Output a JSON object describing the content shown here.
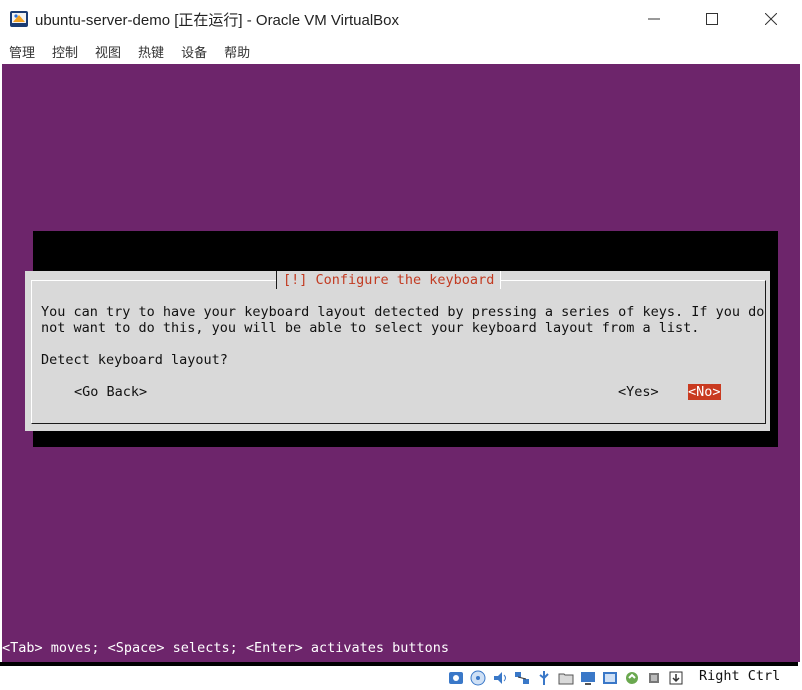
{
  "window": {
    "title": "ubuntu-server-demo [正在运行] - Oracle VM VirtualBox",
    "minimize_icon": "minimize-icon",
    "maximize_icon": "maximize-icon",
    "close_icon": "close-icon"
  },
  "menubar": {
    "items": [
      {
        "label": "管理"
      },
      {
        "label": "控制"
      },
      {
        "label": "视图"
      },
      {
        "label": "热键"
      },
      {
        "label": "设备"
      },
      {
        "label": "帮助"
      }
    ]
  },
  "vm": {
    "background_color": "#6d256b",
    "dialog": {
      "title": "[!] Configure the keyboard",
      "line1": "You can try to have your keyboard layout detected by pressing a series of keys. If you do",
      "line2": "not want to do this, you will be able to select your keyboard layout from a list.",
      "question": "Detect keyboard layout?",
      "buttons": {
        "go_back": "<Go Back>",
        "yes": "<Yes>",
        "no": "<No>"
      },
      "selected_button": "no",
      "accent_color": "#c93a20"
    },
    "help_line": "<Tab> moves; <Space> selects; <Enter> activates buttons"
  },
  "statusbar": {
    "icons": [
      "hard-disk-icon",
      "optical-drive-icon",
      "audio-icon",
      "network-icon",
      "usb-icon",
      "shared-folders-icon",
      "display-icon",
      "recording-icon",
      "mouse-integration-icon",
      "cpu-activity-icon",
      "keyboard-capture-icon"
    ],
    "host_key": "Right Ctrl"
  }
}
